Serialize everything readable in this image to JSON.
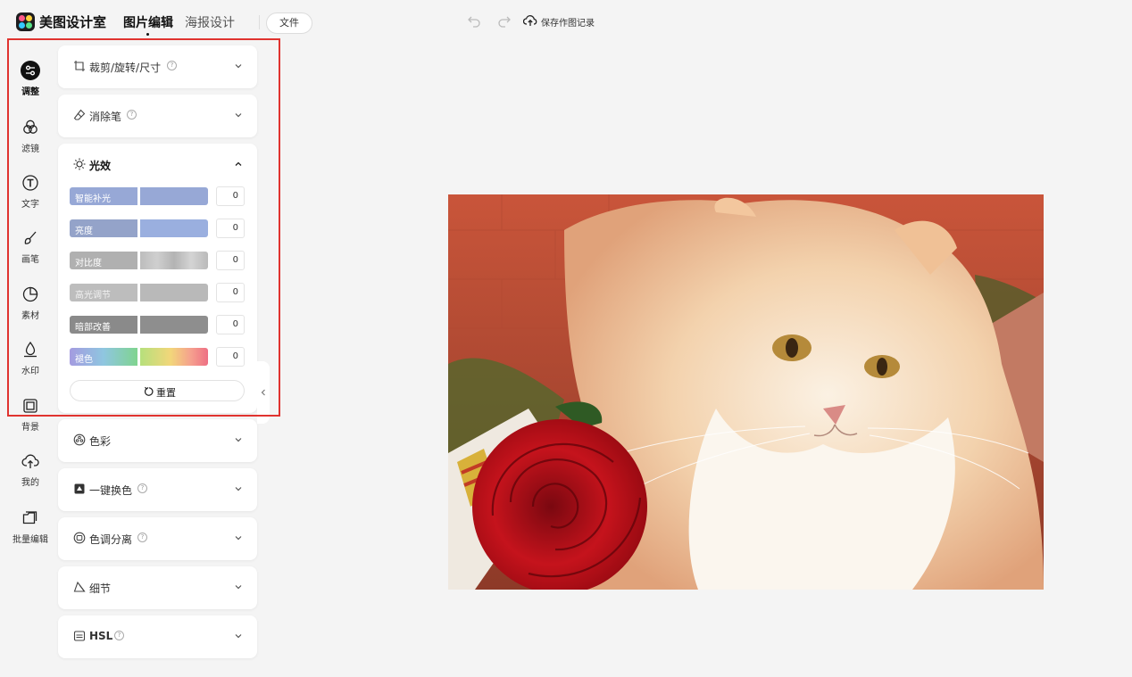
{
  "app": {
    "name": "美图设计室"
  },
  "top_tabs": [
    {
      "label": "图片编辑",
      "active": true
    },
    {
      "label": "海报设计",
      "active": false
    }
  ],
  "toolbar": {
    "file_label": "文件",
    "save_history_label": "保存作图记录"
  },
  "rail": {
    "items": [
      {
        "label": "调整",
        "icon": "adjust-icon",
        "active": true
      },
      {
        "label": "滤镜",
        "icon": "filter-icon"
      },
      {
        "label": "文字",
        "icon": "text-icon"
      },
      {
        "label": "画笔",
        "icon": "brush-icon"
      },
      {
        "label": "素材",
        "icon": "material-icon"
      },
      {
        "label": "水印",
        "icon": "watermark-icon"
      },
      {
        "label": "背景",
        "icon": "background-icon"
      },
      {
        "label": "我的",
        "icon": "cloud-upload-icon"
      },
      {
        "label": "批量编辑",
        "icon": "batch-edit-icon"
      }
    ]
  },
  "panels": {
    "crop": {
      "title": "裁剪/旋转/尺寸"
    },
    "eraser": {
      "title": "消除笔"
    },
    "light": {
      "title": "光效",
      "sliders": [
        {
          "label": "智能补光",
          "value": "0"
        },
        {
          "label": "亮度",
          "value": "0"
        },
        {
          "label": "对比度",
          "value": "0"
        },
        {
          "label": "高光调节",
          "value": "0"
        },
        {
          "label": "暗部改善",
          "value": "0"
        },
        {
          "label": "褪色",
          "value": "0"
        }
      ],
      "reset_label": "重置"
    },
    "color": {
      "title": "色彩"
    },
    "one_click_recolor": {
      "title": "一键换色"
    },
    "tone_split": {
      "title": "色调分离"
    },
    "detail": {
      "title": "细节"
    },
    "hsl": {
      "title": "HSL"
    }
  },
  "colors": {
    "accent_highlight": "#e0332f",
    "slider_blue": "#97a8d6",
    "slider_gray": "#b7b7b7",
    "slider_dark": "#8e8e8e"
  }
}
